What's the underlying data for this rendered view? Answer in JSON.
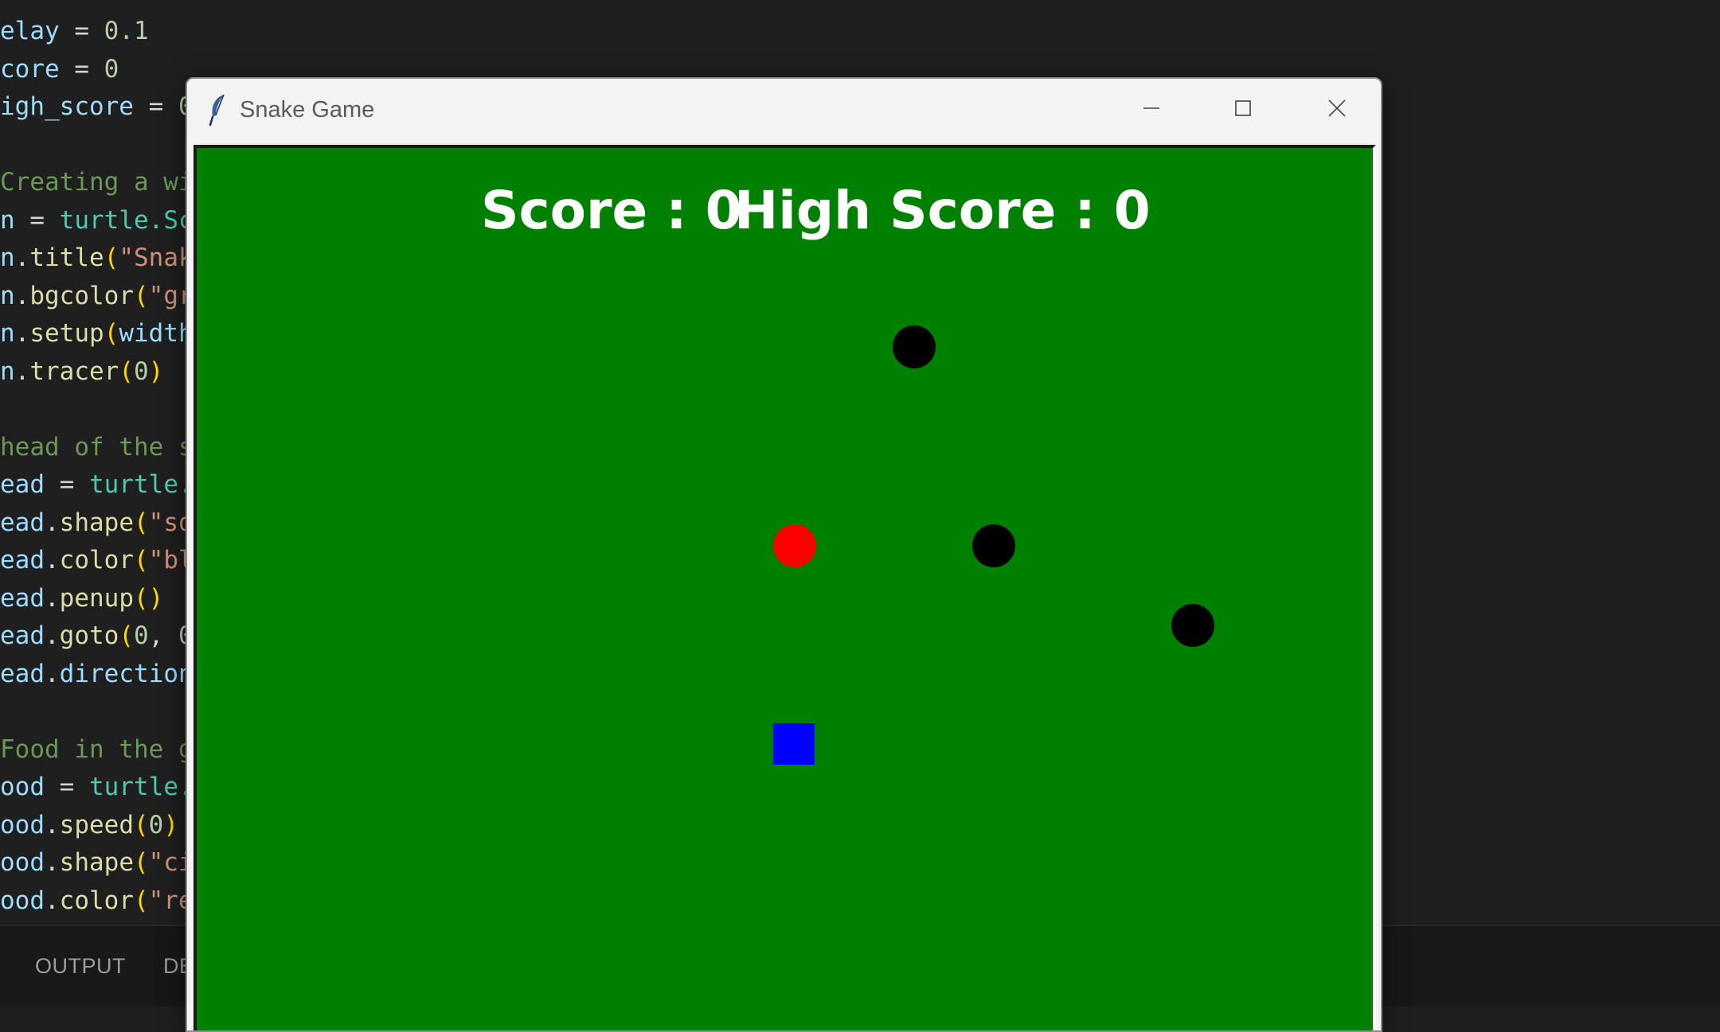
{
  "editor": {
    "lines": [
      [
        {
          "t": "elay",
          "c": "tok-var"
        },
        {
          "t": " = ",
          "c": "tok-op"
        },
        {
          "t": "0.1",
          "c": "tok-num"
        }
      ],
      [
        {
          "t": "core",
          "c": "tok-var"
        },
        {
          "t": " = ",
          "c": "tok-op"
        },
        {
          "t": "0",
          "c": "tok-num"
        }
      ],
      [
        {
          "t": "igh_score",
          "c": "tok-var"
        },
        {
          "t": " = ",
          "c": "tok-op"
        },
        {
          "t": "0",
          "c": "tok-num"
        }
      ],
      [],
      [
        {
          "t": "Creating a wi",
          "c": "tok-com"
        }
      ],
      [
        {
          "t": "n",
          "c": "tok-var"
        },
        {
          "t": " = ",
          "c": "tok-op"
        },
        {
          "t": "turtle",
          "c": "tok-cls"
        },
        {
          "t": ".Sc",
          "c": "tok-cls"
        }
      ],
      [
        {
          "t": "n",
          "c": "tok-var"
        },
        {
          "t": ".",
          "c": "tok-op"
        },
        {
          "t": "title",
          "c": "tok-fn"
        },
        {
          "t": "(",
          "c": "tok-par"
        },
        {
          "t": "\"Snak",
          "c": "tok-str"
        }
      ],
      [
        {
          "t": "n",
          "c": "tok-var"
        },
        {
          "t": ".",
          "c": "tok-op"
        },
        {
          "t": "bgcolor",
          "c": "tok-fn"
        },
        {
          "t": "(",
          "c": "tok-par"
        },
        {
          "t": "\"gr",
          "c": "tok-str"
        }
      ],
      [
        {
          "t": "n",
          "c": "tok-var"
        },
        {
          "t": ".",
          "c": "tok-op"
        },
        {
          "t": "setup",
          "c": "tok-fn"
        },
        {
          "t": "(",
          "c": "tok-par"
        },
        {
          "t": "width",
          "c": "tok-kw"
        }
      ],
      [
        {
          "t": "n",
          "c": "tok-var"
        },
        {
          "t": ".",
          "c": "tok-op"
        },
        {
          "t": "tracer",
          "c": "tok-fn"
        },
        {
          "t": "(",
          "c": "tok-par"
        },
        {
          "t": "0",
          "c": "tok-num"
        },
        {
          "t": ")",
          "c": "tok-par"
        }
      ],
      [],
      [
        {
          "t": "head of the s",
          "c": "tok-com"
        }
      ],
      [
        {
          "t": "ead",
          "c": "tok-var"
        },
        {
          "t": " = ",
          "c": "tok-op"
        },
        {
          "t": "turtle.",
          "c": "tok-cls"
        }
      ],
      [
        {
          "t": "ead",
          "c": "tok-var"
        },
        {
          "t": ".",
          "c": "tok-op"
        },
        {
          "t": "shape",
          "c": "tok-fn"
        },
        {
          "t": "(",
          "c": "tok-par"
        },
        {
          "t": "\"sq",
          "c": "tok-str"
        }
      ],
      [
        {
          "t": "ead",
          "c": "tok-var"
        },
        {
          "t": ".",
          "c": "tok-op"
        },
        {
          "t": "color",
          "c": "tok-fn"
        },
        {
          "t": "(",
          "c": "tok-par"
        },
        {
          "t": "\"bl",
          "c": "tok-str"
        }
      ],
      [
        {
          "t": "ead",
          "c": "tok-var"
        },
        {
          "t": ".",
          "c": "tok-op"
        },
        {
          "t": "penup",
          "c": "tok-fn"
        },
        {
          "t": "()",
          "c": "tok-par"
        }
      ],
      [
        {
          "t": "ead",
          "c": "tok-var"
        },
        {
          "t": ".",
          "c": "tok-op"
        },
        {
          "t": "goto",
          "c": "tok-fn"
        },
        {
          "t": "(",
          "c": "tok-par"
        },
        {
          "t": "0",
          "c": "tok-num"
        },
        {
          "t": ", ",
          "c": "tok-op"
        },
        {
          "t": "0",
          "c": "tok-num"
        }
      ],
      [
        {
          "t": "ead",
          "c": "tok-var"
        },
        {
          "t": ".",
          "c": "tok-op"
        },
        {
          "t": "direction",
          "c": "tok-var"
        }
      ],
      [],
      [
        {
          "t": "Food in the g",
          "c": "tok-com"
        }
      ],
      [
        {
          "t": "ood",
          "c": "tok-var"
        },
        {
          "t": " = ",
          "c": "tok-op"
        },
        {
          "t": "turtle.",
          "c": "tok-cls"
        }
      ],
      [
        {
          "t": "ood",
          "c": "tok-var"
        },
        {
          "t": ".",
          "c": "tok-op"
        },
        {
          "t": "speed",
          "c": "tok-fn"
        },
        {
          "t": "(",
          "c": "tok-par"
        },
        {
          "t": "0",
          "c": "tok-num"
        },
        {
          "t": ")",
          "c": "tok-par"
        }
      ],
      [
        {
          "t": "ood",
          "c": "tok-var"
        },
        {
          "t": ".",
          "c": "tok-op"
        },
        {
          "t": "shape",
          "c": "tok-fn"
        },
        {
          "t": "(",
          "c": "tok-par"
        },
        {
          "t": "\"ci",
          "c": "tok-str"
        }
      ],
      [
        {
          "t": "ood",
          "c": "tok-var"
        },
        {
          "t": ".",
          "c": "tok-op"
        },
        {
          "t": "color",
          "c": "tok-fn"
        },
        {
          "t": "(",
          "c": "tok-par"
        },
        {
          "t": "\"re",
          "c": "tok-str"
        }
      ]
    ]
  },
  "panel": {
    "tabs": [
      "OUTPUT",
      "DE"
    ]
  },
  "window": {
    "title": "Snake Game",
    "icon": "feather-icon",
    "controls": [
      "minimize-icon",
      "maximize-icon",
      "close-icon"
    ]
  },
  "game": {
    "background": "#008000",
    "score_text": "Score : 0",
    "high_score_text": "High Score : 0",
    "head_color": "#0000ff",
    "food_color": "#ff0000",
    "obstacle_color": "#000000"
  }
}
